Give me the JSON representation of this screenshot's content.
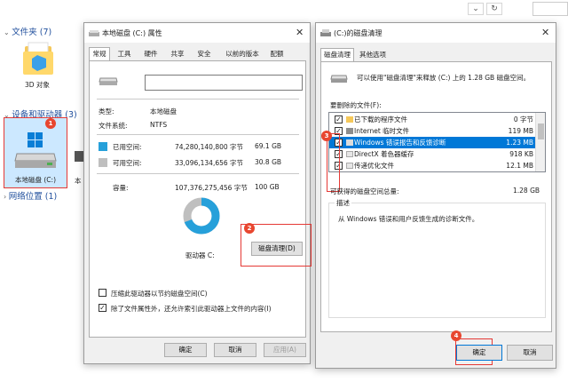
{
  "explorer": {
    "sections": {
      "folders": "文件夹 (7)",
      "devices": "设备和驱动器 (3)",
      "network": "网络位置 (1)"
    },
    "items": {
      "objects3d": "3D 对象",
      "local_disk": "本地磁盘 (C:)",
      "disk_d_partial": "本"
    },
    "toolbar": {
      "back": "‹",
      "refresh": "↻"
    }
  },
  "properties": {
    "title": "本地磁盘 (C:) 属性",
    "tabs": [
      "常规",
      "工具",
      "硬件",
      "共享",
      "安全",
      "以前的版本",
      "配额"
    ],
    "type_label": "类型:",
    "type_value": "本地磁盘",
    "fs_label": "文件系统:",
    "fs_value": "NTFS",
    "used_label": "已用空间:",
    "used_bytes": "74,280,140,800 字节",
    "used_gb": "69.1 GB",
    "free_label": "可用空间:",
    "free_bytes": "33,096,134,656 字节",
    "free_gb": "30.8 GB",
    "cap_label": "容量:",
    "cap_bytes": "107,376,275,456 字节",
    "cap_gb": "100 GB",
    "drive_label": "驱动器 C:",
    "cleanup_button": "磁盘清理(D)",
    "compress_label": "压缩此驱动器以节约磁盘空间(C)",
    "index_label": "除了文件属性外，还允许索引此驱动器上文件的内容(I)",
    "ok": "确定",
    "cancel": "取消",
    "apply": "应用(A)",
    "used_fraction": 0.692,
    "used_color": "#26a0da",
    "free_color": "#bfbfbf"
  },
  "cleanup": {
    "title": "(C:)的磁盘清理",
    "tabs": [
      "磁盘清理",
      "其他选项"
    ],
    "info": "可以使用\"磁盘清理\"来释放 (C:) 上的 1.28 GB 磁盘空间。",
    "files_label": "要删除的文件(F):",
    "files": [
      {
        "name": "已下载的程序文件",
        "size": "0 字节",
        "checked": true,
        "selected": false
      },
      {
        "name": "Internet 临时文件",
        "size": "119 MB",
        "checked": true,
        "selected": false
      },
      {
        "name": "Windows 错误报告和反馈诊断",
        "size": "1.23 MB",
        "checked": true,
        "selected": true
      },
      {
        "name": "DirectX 着色器缓存",
        "size": "918 KB",
        "checked": true,
        "selected": false
      },
      {
        "name": "传递优化文件",
        "size": "12.1 MB",
        "checked": true,
        "selected": false
      }
    ],
    "total_label": "可获得的磁盘空间总量:",
    "total_value": "1.28 GB",
    "desc_title": "描述",
    "desc_text": "从 Windows 错误和用户反馈生成的诊断文件。",
    "ok": "确定",
    "cancel": "取消"
  },
  "badges": [
    "1",
    "2",
    "3",
    "4"
  ]
}
